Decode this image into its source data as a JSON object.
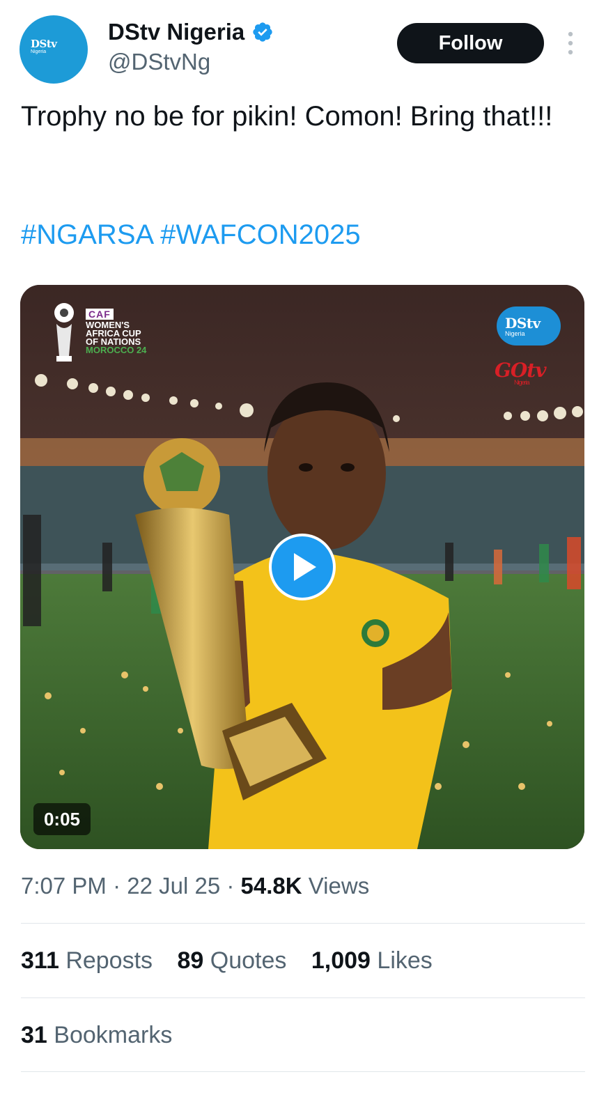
{
  "author": {
    "display_name": "DStv Nigeria",
    "handle": "@DStvNg",
    "verified": true,
    "avatar_brand": "DStv",
    "avatar_sub": "Nigeria"
  },
  "follow_label": "Follow",
  "tweet": {
    "text": "Trophy no be for pikin! Comon! Bring that!!!",
    "hashtags": [
      "#NGARSA",
      "#WAFCON2025"
    ]
  },
  "media": {
    "type": "video",
    "duration": "0:05",
    "overlay": {
      "caf_badge": "CAF",
      "caf_lines": [
        "WOMEN'S",
        "AFRICA CUP",
        "OF NATIONS",
        "MOROCCO 24"
      ],
      "dstv_brand": "DStv",
      "dstv_sub": "Nigeria",
      "gotv_brand": "GOtv",
      "gotv_sub": "Nigeria"
    }
  },
  "meta": {
    "time": "7:07 PM",
    "separator": "·",
    "date": "22 Jul 25",
    "views_count": "54.8K",
    "views_label": "Views"
  },
  "stats": {
    "reposts_count": "311",
    "reposts_label": "Reposts",
    "quotes_count": "89",
    "quotes_label": "Quotes",
    "likes_count": "1,009",
    "likes_label": "Likes",
    "bookmarks_count": "31",
    "bookmarks_label": "Bookmarks"
  },
  "colors": {
    "accent": "#1d9bf0",
    "text_primary": "#0f1419",
    "text_secondary": "#536471",
    "follow_bg": "#0f1419",
    "avatar_bg": "#1d9bd7"
  },
  "icons": [
    "verified-badge-icon",
    "more-options-icon",
    "play-icon"
  ]
}
